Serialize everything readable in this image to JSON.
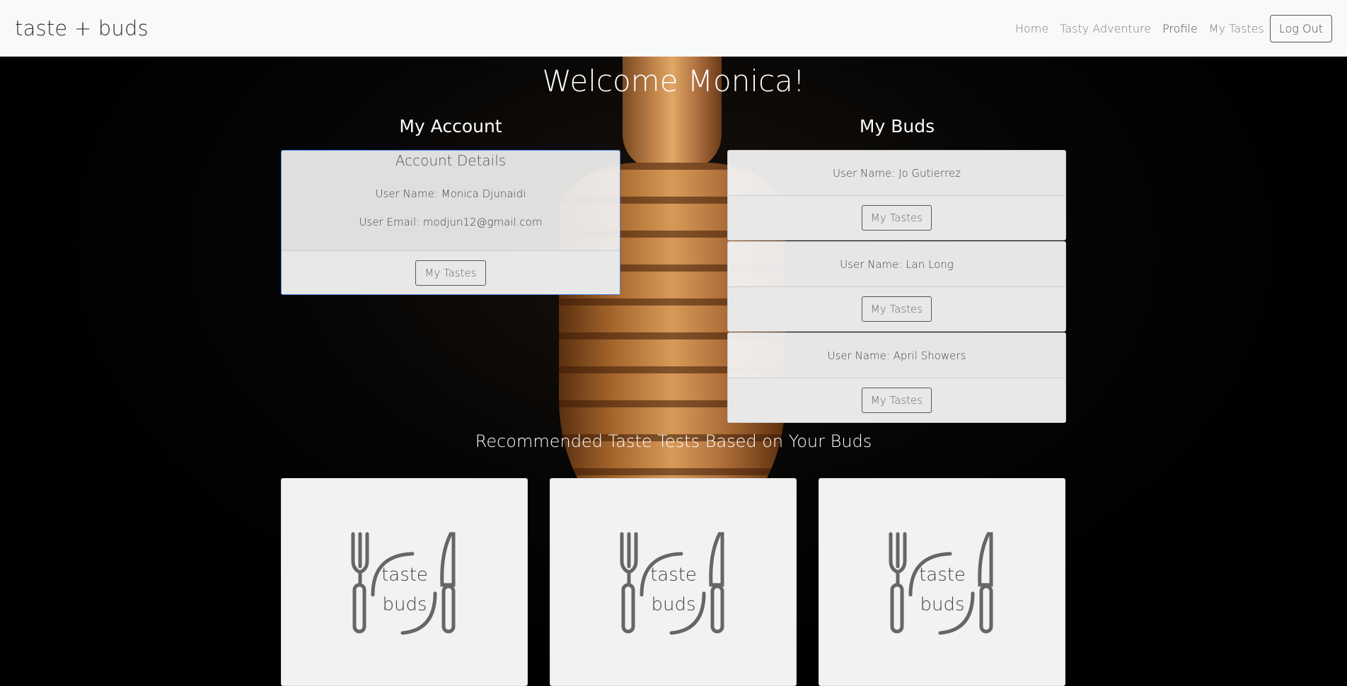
{
  "navbar": {
    "brand": "taste + buds",
    "links": [
      "Home",
      "Tasty Adventure",
      "Profile",
      "My Tastes"
    ],
    "logout": "Log Out"
  },
  "welcome": "Welcome Monica!",
  "account": {
    "section_title": "My Account",
    "card_title": "Account Details",
    "user_name": "User Name: Monica Djunaidi",
    "user_email": "User Email: modjun12@gmail.com",
    "button": "My Tastes"
  },
  "buds": {
    "section_title": "My Buds",
    "items": [
      {
        "name": "User Name: Jo Gutierrez",
        "button": "My Tastes"
      },
      {
        "name": "User Name: Lan Long",
        "button": "My Tastes"
      },
      {
        "name": "User Name: April Showers",
        "button": "My Tastes"
      }
    ]
  },
  "recommended": {
    "title": "Recommended Taste Tests Based on Your Buds",
    "cards": [
      {
        "logo_line1": "taste",
        "logo_line2": "buds"
      },
      {
        "logo_line1": "taste",
        "logo_line2": "buds"
      },
      {
        "logo_line1": "taste",
        "logo_line2": "buds"
      }
    ]
  },
  "icons": {
    "logo": "fork-knife-logo-icon",
    "background": "honey-dipper-photo"
  }
}
